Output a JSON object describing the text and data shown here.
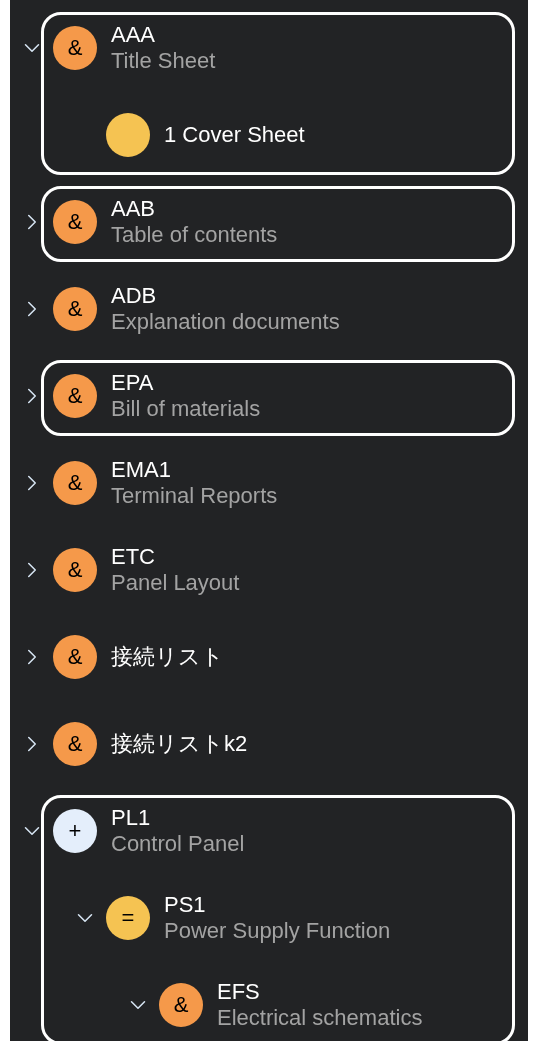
{
  "tree": [
    {
      "kind": "group",
      "expanded": true,
      "highlighted": true,
      "symbol": "&",
      "color": "#f5994a",
      "label": "AAA",
      "subtitle": "Title Sheet",
      "children": [
        {
          "kind": "leaf",
          "color": "#f5c352",
          "label": "1 Cover Sheet"
        }
      ]
    },
    {
      "kind": "group",
      "expanded": false,
      "highlighted": true,
      "symbol": "&",
      "color": "#f5994a",
      "label": "AAB",
      "subtitle": "Table of contents"
    },
    {
      "kind": "group",
      "expanded": false,
      "highlighted": false,
      "symbol": "&",
      "color": "#f5994a",
      "label": "ADB",
      "subtitle": "Explanation documents"
    },
    {
      "kind": "group",
      "expanded": false,
      "highlighted": true,
      "symbol": "&",
      "color": "#f5994a",
      "label": "EPA",
      "subtitle": "Bill of materials"
    },
    {
      "kind": "group",
      "expanded": false,
      "highlighted": false,
      "symbol": "&",
      "color": "#f5994a",
      "label": "EMA1",
      "subtitle": "Terminal Reports"
    },
    {
      "kind": "group",
      "expanded": false,
      "highlighted": false,
      "symbol": "&",
      "color": "#f5994a",
      "label": "ETC",
      "subtitle": "Panel Layout"
    },
    {
      "kind": "group",
      "expanded": false,
      "highlighted": false,
      "symbol": "&",
      "color": "#f5994a",
      "label": "接続リスト"
    },
    {
      "kind": "group",
      "expanded": false,
      "highlighted": false,
      "symbol": "&",
      "color": "#f5994a",
      "label": "接続リストk2"
    },
    {
      "kind": "group",
      "expanded": true,
      "highlighted": true,
      "symbol": "+",
      "color": "#e4eefb",
      "label": "PL1",
      "subtitle": "Control Panel",
      "children": [
        {
          "kind": "group",
          "expanded": true,
          "symbol": "=",
          "color": "#f5c352",
          "label": "PS1",
          "subtitle": "Power Supply Function",
          "children": [
            {
              "kind": "group",
              "expanded": true,
              "symbol": "&",
              "color": "#f5994a",
              "label": "EFS",
              "subtitle": "Electrical schematics"
            }
          ]
        }
      ]
    }
  ]
}
